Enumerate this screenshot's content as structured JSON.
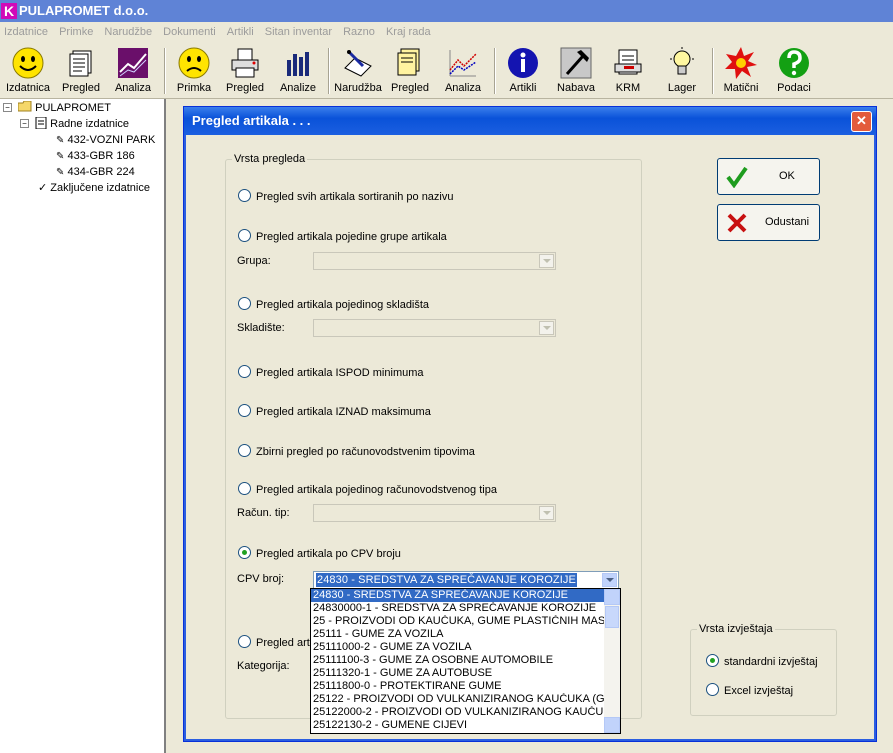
{
  "app": {
    "title": "PULAPROMET d.o.o."
  },
  "menu": [
    "Izdatnice",
    "Primke",
    "Narudžbe",
    "Dokumenti",
    "Artikli",
    "Sitan inventar",
    "Razno",
    "Kraj rada"
  ],
  "toolbar": {
    "izdatnica": "Izdatnica",
    "pregled1": "Pregled",
    "analiza1": "Analiza",
    "primka": "Primka",
    "pregled2": "Pregled",
    "analize": "Analize",
    "narudzba": "Narudžba",
    "pregled3": "Pregled",
    "analiza3": "Analiza",
    "artikli": "Artikli",
    "nabava": "Nabava",
    "krm": "KRM",
    "lager": "Lager",
    "maticni": "Matični",
    "podaci": "Podaci"
  },
  "tree": {
    "root": "PULAPROMET",
    "radne": "Radne izdatnice",
    "item1": "432-VOZNI PARK",
    "item2": "433-GBR 186",
    "item3": "434-GBR 224",
    "zakljucene": "Zaključene izdatnice"
  },
  "dialog": {
    "title": "Pregled artikala . . .",
    "group_title": "Vrsta pregleda",
    "options": {
      "o1": "Pregled svih artikala sortiranih po nazivu",
      "o2": "Pregled artikala pojedine grupe artikala",
      "o3": "Pregled artikala pojedinog skladišta",
      "o4": "Pregled artikala ISPOD minimuma",
      "o5": "Pregled artikala IZNAD maksimuma",
      "o6": "Zbirni pregled po računovodstvenim tipovima",
      "o7": "Pregled artikala pojedinog računovodstvenog  tipa",
      "o8": "Pregled artikala po CPV broju",
      "o9": "Pregled artik"
    },
    "labels": {
      "grupa": "Grupa:",
      "skladiste": "Skladište:",
      "racun_tip": "Račun. tip:",
      "cpv_broj": "CPV broj:",
      "kategorija": "Kategorija:"
    },
    "cpv_selected": "24830  -  SREDSTVA ZA SPREČAVANJE KOROZIJE",
    "cpv_list": [
      "24830  -  SREDSTVA ZA SPREČAVANJE KOROZIJE",
      "24830000-1  -  SREDSTVA ZA SPREČAVANJE KOROZIJE",
      "25  -  PROIZVODI OD KAUČUKA, GUME PLASTIČNIH MAS",
      "25111  -  GUME ZA VOZILA",
      "25111000-2  -  GUME ZA VOZILA",
      "25111100-3  -  GUME ZA OSOBNE AUTOMOBILE",
      "25111320-1  -  GUME ZA AUTOBUSE",
      "25111800-0  -  PROTEKTIRANE GUME",
      "25122  -  PROIZVODI OD VULKANIZIRANOG KAUČUKA (G",
      "25122000-2  -  PROIZVODI OD VULKANIZIRANOG KAUČU",
      "25122130-2  -  GUMENE CIJEVI"
    ],
    "ok_label": "OK",
    "cancel_label": "Odustani",
    "report_group_title": "Vrsta izvještaja",
    "report_standard": "standardni izvještaj",
    "report_excel": "Excel izvještaj"
  }
}
